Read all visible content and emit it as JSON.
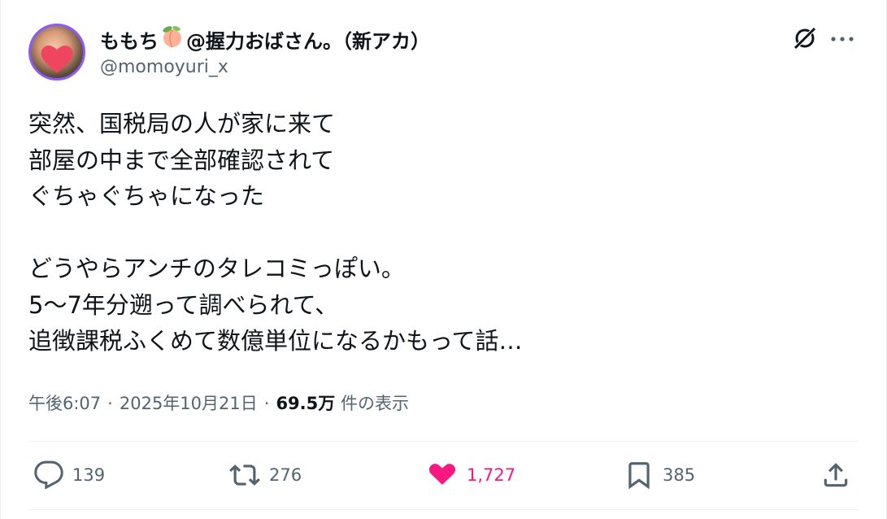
{
  "tweet": {
    "display_name": "ももち",
    "display_name_suffix": "@握力おばさん。（新アカ）",
    "handle": "@momoyuri_x",
    "body": "突然、国税局の人が家に来て\n部屋の中まで全部確認されて\nぐちゃぐちゃになった\n\nどうやらアンチのタレコミっぽい。\n5〜7年分遡って調べられて、\n追徴課税ふくめて数億単位になるかもって話…",
    "time": "午後6:07",
    "separator": "·",
    "date": "2025年10月21日",
    "views_count": "69.5万",
    "views_label": "件の表示"
  },
  "actions": {
    "replies": "139",
    "reposts": "276",
    "likes": "1,727",
    "bookmarks": "385"
  },
  "icons": {
    "peach": "peach-emoji",
    "grok": "grok-icon",
    "more": "more-icon",
    "reply": "reply-icon",
    "repost": "repost-icon",
    "like": "heart-icon",
    "bookmark": "bookmark-icon",
    "share": "share-icon"
  },
  "colors": {
    "text": "#0f1419",
    "secondary": "#536471",
    "like": "#f91880",
    "avatar_border": "#8b5cf6"
  }
}
